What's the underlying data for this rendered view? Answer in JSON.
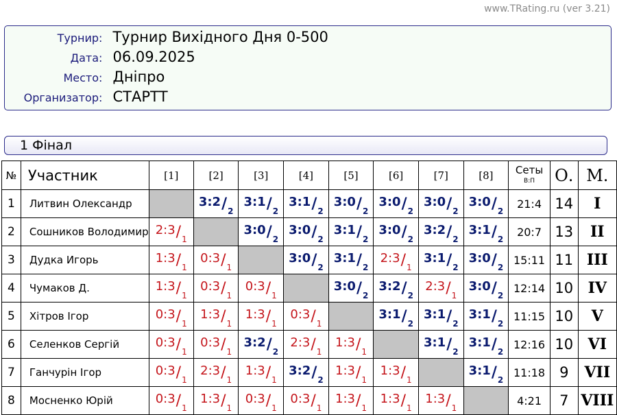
{
  "credit": "www.TRating.ru (ver 3.21)",
  "info": {
    "tournament": {
      "label": "Турнир",
      "value": "Турнир Вихідного Дня 0-500"
    },
    "date": {
      "label": "Дата",
      "value": "06.09.2025"
    },
    "place": {
      "label": "Место",
      "value": "Дніпро"
    },
    "organizer": {
      "label": "Организатор",
      "value": "СТАРТТ"
    }
  },
  "section_title": "1 Фінал",
  "headers": {
    "num": "№",
    "name": "Участник",
    "cols": [
      "[1]",
      "[2]",
      "[3]",
      "[4]",
      "[5]",
      "[6]",
      "[7]",
      "[8]"
    ],
    "sets": "Сеты",
    "sets_sub": "В:П",
    "points": "О.",
    "place": "М."
  },
  "players": [
    {
      "num": "1",
      "name": "Литвин Олександр",
      "results": [
        null,
        {
          "score": "3:2",
          "pts": "2"
        },
        {
          "score": "3:1",
          "pts": "2"
        },
        {
          "score": "3:1",
          "pts": "2"
        },
        {
          "score": "3:0",
          "pts": "2"
        },
        {
          "score": "3:0",
          "pts": "2"
        },
        {
          "score": "3:0",
          "pts": "2"
        },
        {
          "score": "3:0",
          "pts": "2"
        }
      ],
      "sets": "21:4",
      "points": "14",
      "place": "I"
    },
    {
      "num": "2",
      "name": "Сошников Володимир",
      "results": [
        {
          "score": "2:3",
          "pts": "1"
        },
        null,
        {
          "score": "3:0",
          "pts": "2"
        },
        {
          "score": "3:0",
          "pts": "2"
        },
        {
          "score": "3:1",
          "pts": "2"
        },
        {
          "score": "3:0",
          "pts": "2"
        },
        {
          "score": "3:2",
          "pts": "2"
        },
        {
          "score": "3:1",
          "pts": "2"
        }
      ],
      "sets": "20:7",
      "points": "13",
      "place": "II"
    },
    {
      "num": "3",
      "name": "Дудка Игорь",
      "results": [
        {
          "score": "1:3",
          "pts": "1"
        },
        {
          "score": "0:3",
          "pts": "1"
        },
        null,
        {
          "score": "3:0",
          "pts": "2"
        },
        {
          "score": "3:1",
          "pts": "2"
        },
        {
          "score": "2:3",
          "pts": "1"
        },
        {
          "score": "3:1",
          "pts": "2"
        },
        {
          "score": "3:0",
          "pts": "2"
        }
      ],
      "sets": "15:11",
      "points": "11",
      "place": "III"
    },
    {
      "num": "4",
      "name": "Чумаков Д.",
      "results": [
        {
          "score": "1:3",
          "pts": "1"
        },
        {
          "score": "0:3",
          "pts": "1"
        },
        {
          "score": "0:3",
          "pts": "1"
        },
        null,
        {
          "score": "3:0",
          "pts": "2"
        },
        {
          "score": "3:2",
          "pts": "2"
        },
        {
          "score": "2:3",
          "pts": "1"
        },
        {
          "score": "3:0",
          "pts": "2"
        }
      ],
      "sets": "12:14",
      "points": "10",
      "place": "IV"
    },
    {
      "num": "5",
      "name": "Хітров Ігор",
      "results": [
        {
          "score": "0:3",
          "pts": "1"
        },
        {
          "score": "1:3",
          "pts": "1"
        },
        {
          "score": "1:3",
          "pts": "1"
        },
        {
          "score": "0:3",
          "pts": "1"
        },
        null,
        {
          "score": "3:1",
          "pts": "2"
        },
        {
          "score": "3:1",
          "pts": "2"
        },
        {
          "score": "3:1",
          "pts": "2"
        }
      ],
      "sets": "11:15",
      "points": "10",
      "place": "V"
    },
    {
      "num": "6",
      "name": "Селенков Сергій",
      "results": [
        {
          "score": "0:3",
          "pts": "1"
        },
        {
          "score": "0:3",
          "pts": "1"
        },
        {
          "score": "3:2",
          "pts": "2"
        },
        {
          "score": "2:3",
          "pts": "1"
        },
        {
          "score": "1:3",
          "pts": "1"
        },
        null,
        {
          "score": "3:1",
          "pts": "2"
        },
        {
          "score": "3:1",
          "pts": "2"
        }
      ],
      "sets": "12:16",
      "points": "10",
      "place": "VI"
    },
    {
      "num": "7",
      "name": "Ганчурін Ігор",
      "results": [
        {
          "score": "0:3",
          "pts": "1"
        },
        {
          "score": "2:3",
          "pts": "1"
        },
        {
          "score": "1:3",
          "pts": "1"
        },
        {
          "score": "3:2",
          "pts": "2"
        },
        {
          "score": "1:3",
          "pts": "1"
        },
        {
          "score": "1:3",
          "pts": "1"
        },
        null,
        {
          "score": "3:1",
          "pts": "2"
        }
      ],
      "sets": "11:18",
      "points": "9",
      "place": "VII"
    },
    {
      "num": "8",
      "name": "Мосненко Юрій",
      "results": [
        {
          "score": "0:3",
          "pts": "1"
        },
        {
          "score": "1:3",
          "pts": "1"
        },
        {
          "score": "0:3",
          "pts": "1"
        },
        {
          "score": "0:3",
          "pts": "1"
        },
        {
          "score": "1:3",
          "pts": "1"
        },
        {
          "score": "1:3",
          "pts": "1"
        },
        {
          "score": "1:3",
          "pts": "1"
        },
        null
      ],
      "sets": "4:21",
      "points": "7",
      "place": "VIII"
    }
  ],
  "colors": {
    "win": "#0a1a6e",
    "loss": "#c4141a",
    "self": "#c4c4c4"
  }
}
